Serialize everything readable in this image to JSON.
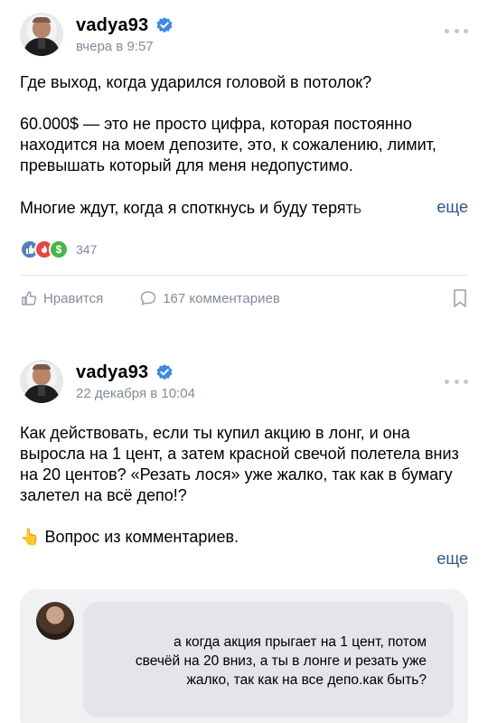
{
  "posts": [
    {
      "author": "vadya93",
      "time": "вчера в 9:57",
      "paragraphs": [
        "Где выход, когда ударился головой в потолок?",
        "60.000$ — это не просто цифра, которая постоянно находится на моем депозите, это, к сожалению, лимит, превышать который для меня недопустимо."
      ],
      "truncated_line": "Многие ждут, когда я споткнусь и буду терять",
      "more_label": "еще",
      "reactions_count": "347",
      "like_label": "Нравится",
      "comments_label": "167 комментариев"
    },
    {
      "author": "vadya93",
      "time": "22 декабря в 10:04",
      "paragraphs": [
        "Как действовать, если ты купил акцию в лонг, и она выросла на 1 цент, а затем красной свечой полетела вниз на 20 центов? «Резать лося» уже жалко, так как в бумагу залетел на всё депо!?"
      ],
      "question_emoji": "👆",
      "question_line": "Вопрос из комментариев.",
      "more_label": "еще",
      "quote_text": "а когда акция прыгает на 1 цент, потом свечёй на 20 вниз, а ты в лонге и резать уже жалко, так как на все депо.как быть?"
    }
  ],
  "colors": {
    "link": "#2a5885",
    "secondary": "#818c99",
    "verified": "#3f8ae0",
    "divider": "#e7e8ec",
    "quote_bg": "#f0f1f3"
  },
  "icons": [
    "verified-badge-icon",
    "more-dots-icon",
    "like-reaction-icon",
    "fire-reaction-icon",
    "money-reaction-icon",
    "thumbs-up-icon",
    "comment-icon",
    "bookmark-icon"
  ]
}
